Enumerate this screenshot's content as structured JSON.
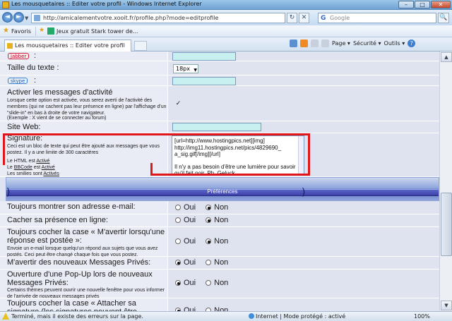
{
  "window": {
    "title": "Les mousquetaires :: Editer votre profil - Windows Internet Explorer",
    "btn_min": "–",
    "btn_max": "□",
    "btn_close": "✕"
  },
  "address": {
    "url": "http://amicalementvotre.xooit.fr/profile.php?mode=editprofile",
    "search_placeholder": "Google",
    "back": "◄",
    "forward": "►",
    "dropdown": "▼",
    "refresh": "↻",
    "stop": "✕",
    "search_btn": "🔍"
  },
  "favorites": {
    "label": "Favoris",
    "item1": "Jeux gratuit Stark tower de..."
  },
  "tabs": {
    "active": "Les mousquetaires :: Editer votre profil"
  },
  "commands": {
    "page": "Page ▾",
    "security": "Sécurité ▾",
    "tools": "Outils ▾",
    "help": "?"
  },
  "form": {
    "jabber": {
      "badge": "jabber",
      "colon": ":"
    },
    "text_size": {
      "label": "Taille du texte :",
      "value": "18px"
    },
    "skype": {
      "badge": "skype",
      "colon": ":"
    },
    "activity": {
      "label": "Activer les messages d'activité",
      "desc": "Lorsque cette option est activée, vous serez averti de l'activité des membres (qui ne cachent pas leur présence en ligne) par l'affichage d'un \"slide-in\" en bas à droite de votre navigateur.",
      "example": "(Exemple : X vient de se connecter au forum)",
      "check": "✓"
    },
    "website": {
      "label": "Site Web:"
    },
    "signature": {
      "label": "Signature:",
      "desc": "Ceci est un bloc de texte qui peut être ajouté aux messages que vous postez. Il y a une limite de 300 caractères",
      "value_line1": "[url=http://www.hostingpics.net][img]",
      "value_line2": "http://img11.hostingpics.net/pics/4829690_",
      "value_line3": "a_sig.gif[/img][/url]",
      "value_line4": "Il n'y a pas besoin d'être une lumière pour savoir qu'il fait noir. Ph. Geluck",
      "html_prefix": "Le HTML est ",
      "html_state": "Activé",
      "bbcode_prefix": "Le ",
      "bbcode_link": "BBCode",
      "bbcode_mid": " est ",
      "bbcode_state": "Activé",
      "smilies_prefix": "Les smilies sont ",
      "smilies_state": "Activés"
    },
    "preferences_banner": "Préférences",
    "options": {
      "oui": "Oui",
      "non": "Non",
      "email": "Toujours montrer son adresse e-mail:",
      "hide": "Cacher sa présence en ligne:",
      "notify": "Toujours cocher la case « M'avertir lorsqu'une réponse est postée »:",
      "notify_desc": "Envoie un e-mail lorsque quelqu'un répond aux sujets que vous avez postés. Ceci peut être changé chaque fois que vous postez.",
      "pm": "M'avertir des nouveaux Messages Privés:",
      "popup": "Ouverture d'une Pop-Up lors de nouveaux Messages Privés:",
      "popup_desc": "Certains thèmes peuvent ouvrir une nouvelle fenêtre pour vous informer de l'arrivée de nouveaux messages privés",
      "attach": "Toujours cocher la case « Attacher sa signature (les signatures peuvent être"
    }
  },
  "statusbar": {
    "message": "Terminé, mais il existe des erreurs sur la page.",
    "zone": "Internet | Mode protégé : activé",
    "zoom": "100%"
  }
}
